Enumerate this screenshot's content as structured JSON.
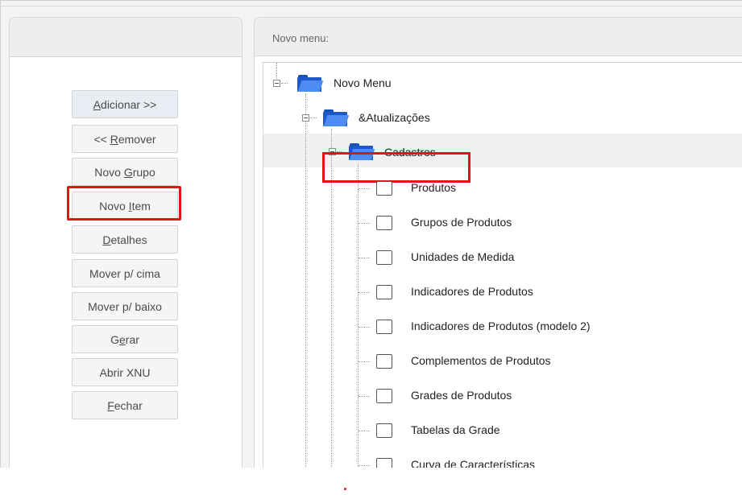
{
  "left_panel": {
    "buttons": {
      "adicionar": {
        "pre": "",
        "u": "A",
        "post": "dicionar >>"
      },
      "remover": {
        "pre": "<< ",
        "u": "R",
        "post": "emover"
      },
      "novo_grupo": {
        "pre": "Novo ",
        "u": "G",
        "post": "rupo"
      },
      "novo_item": {
        "pre": "Novo ",
        "u": "I",
        "post": "tem"
      },
      "detalhes": {
        "pre": "",
        "u": "D",
        "post": "etalhes"
      },
      "mover_cima": {
        "text": "Mover p/ cima"
      },
      "mover_baixo": {
        "text": "Mover p/ baixo"
      },
      "gerar": {
        "pre": "G",
        "u": "e",
        "post": "rar"
      },
      "abrir_xnu": {
        "text": "Abrir XNU"
      },
      "fechar": {
        "pre": "",
        "u": "F",
        "post": "echar"
      }
    }
  },
  "right_panel": {
    "header": "Novo menu:",
    "tree": {
      "root": "Novo Menu",
      "atualizacoes": "&Atualizações",
      "cadastros": "Cadastros",
      "items": [
        "Produtos",
        "Grupos de Produtos",
        "Unidades de Medida",
        "Indicadores de Produtos",
        "Indicadores de Produtos (modelo 2)",
        "Complementos de Produtos",
        "Grades de Produtos",
        "Tabelas da Grade",
        "Curva de Características"
      ]
    }
  },
  "colors": {
    "highlight": "#e31414",
    "folder_blue": "#1d58c8"
  },
  "icons": [
    "folder-open-icon",
    "menu-item-icon",
    "collapse-toggle-icon"
  ]
}
